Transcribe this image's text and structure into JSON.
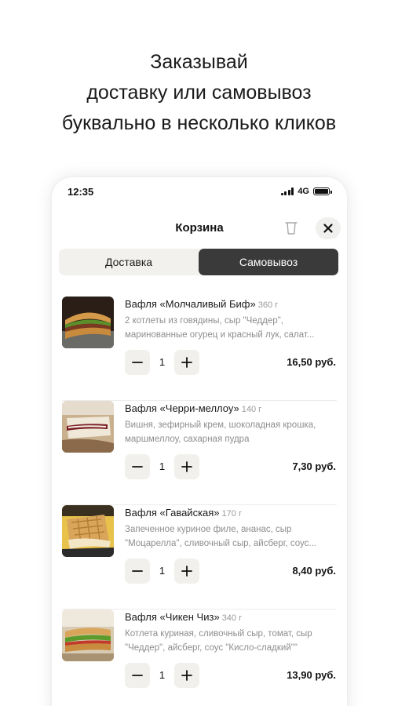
{
  "headline": {
    "line1": "Заказывай",
    "line2": "доставку или самовывоз",
    "line3": "буквально в несколько кликов"
  },
  "status_bar": {
    "time": "12:35",
    "network": "4G"
  },
  "cart": {
    "title": "Корзина",
    "tabs": [
      {
        "label": "Доставка",
        "active": false
      },
      {
        "label": "Самовывоз",
        "active": true
      }
    ],
    "items": [
      {
        "name": "Вафля «Молчаливый Биф»",
        "weight": "360 г",
        "desc_line1": "2 котлеты из говядины, сыр \"Чеддер\",",
        "desc_line2": "маринованные огурец и красный лук, салат...",
        "quantity": "1",
        "price": "16,50 руб."
      },
      {
        "name": "Вафля «Черри-меллоу»",
        "weight": "140 г",
        "desc_line1": "Вишня, зефирный крем, шоколадная крошка,",
        "desc_line2": "маршмеллоу, сахарная пудра",
        "quantity": "1",
        "price": "7,30 руб."
      },
      {
        "name": "Вафля «Гавайская»",
        "weight": "170 г",
        "desc_line1": "Запеченное куриное филе, ананас, сыр",
        "desc_line2": "\"Моцарелла\", сливочный сыр, айсберг, соус...",
        "quantity": "1",
        "price": "8,40 руб."
      },
      {
        "name": "Вафля «Чикен Чиз»",
        "weight": "340 г",
        "desc_line1": "Котлета куриная, сливочный сыр, томат, сыр",
        "desc_line2": "\"Чеддер\", айсберг, соус \"Кисло-сладкий\"\"",
        "quantity": "1",
        "price": "13,90 руб."
      }
    ]
  },
  "colors": {
    "active_tab": "#3a3a3a",
    "tab_bg": "#f2f1ee",
    "stepper_bg": "#f1f0ec",
    "muted_text": "#8e8e8e"
  },
  "icons": [
    "trash-icon",
    "close-icon",
    "minus-icon",
    "plus-icon",
    "signal-icon",
    "battery-icon"
  ]
}
